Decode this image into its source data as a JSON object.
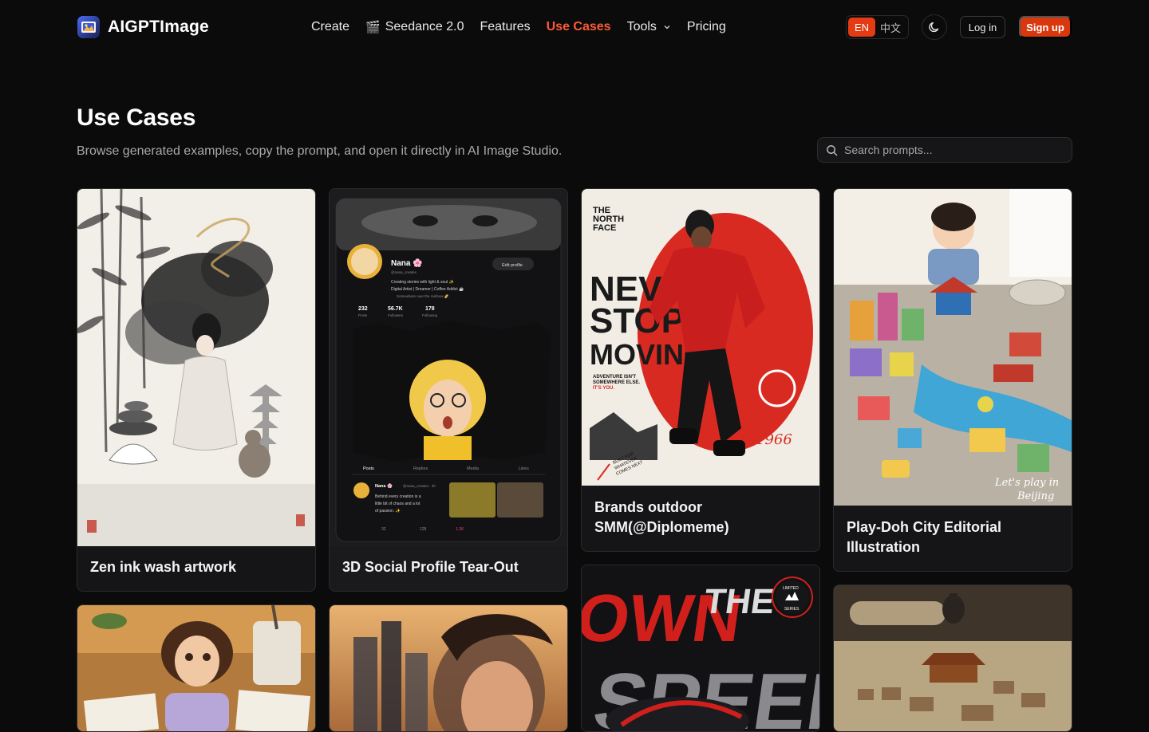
{
  "brand": {
    "name": "AIGPTImage",
    "logo_icon": "image-frame-icon"
  },
  "nav": {
    "items": [
      {
        "label": "Create",
        "icon": ""
      },
      {
        "label": "Seedance 2.0",
        "icon": "🎬"
      },
      {
        "label": "Features",
        "icon": ""
      },
      {
        "label": "Use Cases",
        "icon": "",
        "active": true
      },
      {
        "label": "Tools",
        "icon": "",
        "dropdown": true
      },
      {
        "label": "Pricing",
        "icon": ""
      }
    ]
  },
  "header_actions": {
    "lang_en": "EN",
    "lang_zh": "中文",
    "selected_lang": "EN",
    "theme_icon": "moon-icon",
    "login_label": "Log in",
    "signup_label": "Sign up"
  },
  "page": {
    "title": "Use Cases",
    "subtitle": "Browse generated examples, copy the prompt, and open it directly in AI Image Studio."
  },
  "search": {
    "placeholder": "Search prompts...",
    "value": ""
  },
  "cards": [
    {
      "title": "Zen ink wash artwork"
    },
    {
      "title": "3D Social Profile Tear-Out"
    },
    {
      "title": "Brands outdoor SMM(@Diplomeme)"
    },
    {
      "title": "Play-Doh City Editorial Illustration"
    },
    {
      "title": ""
    },
    {
      "title": ""
    },
    {
      "title": ""
    },
    {
      "title": ""
    }
  ],
  "card_image_text": {
    "profile_name": "Nana 🌸",
    "profile_handle": "@nana_creates",
    "profile_bio_1": "Creating stories with light & soul ✨",
    "profile_bio_2": "Digital Artist | Dreamer | Coffee Addict ☕",
    "profile_location": "Somewhere over the rainbow 🌈",
    "edit_profile": "Edit profile",
    "stat_posts_value": "232",
    "stat_posts_label": "Posts",
    "stat_followers_value": "56.7K",
    "stat_followers_label": "Followers",
    "stat_following_value": "178",
    "stat_following_label": "Following",
    "tab_posts": "Posts",
    "tab_replies": "Replies",
    "tab_media": "Media",
    "tab_likes": "Likes",
    "post_author": "Nana 🌸",
    "post_meta": "@nana_creates · 3h",
    "post_text_1": "Behind every creation is a",
    "post_text_2": "little bit of chaos and a lot",
    "post_text_3": "of passion. ✨",
    "post_replies": "32",
    "post_reposts": "128",
    "post_likes": "1.2K",
    "tnf_brand_1": "THE",
    "tnf_brand_2": "NORTH",
    "tnf_brand_3": "FACE",
    "tnf_headline_1": "NEVER",
    "tnf_headline_2": "STOP",
    "tnf_headline_3": "MOVING",
    "tnf_tagline_1": "ADVENTURE ISN'T",
    "tnf_tagline_2": "SOMEWHERE ELSE.",
    "tnf_tagline_3": "IT'S YOU.",
    "tnf_since": "SINCE",
    "tnf_year": "1966",
    "tnf_built_1": "BUILT FOR",
    "tnf_built_2": "WHATEVER",
    "tnf_built_3": "COMES NEXT",
    "playdoh_caption_1": "Let's play in",
    "playdoh_caption_2": "Beijing",
    "speed_word_1": "OWN",
    "speed_word_2": "THE",
    "speed_word_3": "SPEED",
    "speed_badge_1": "LIMITED",
    "speed_badge_2": "SERIES"
  },
  "colors": {
    "accent": "#ff5a36",
    "signup_bg": "#d9380f",
    "background": "#0b0b0c",
    "card_bg": "#151517"
  }
}
